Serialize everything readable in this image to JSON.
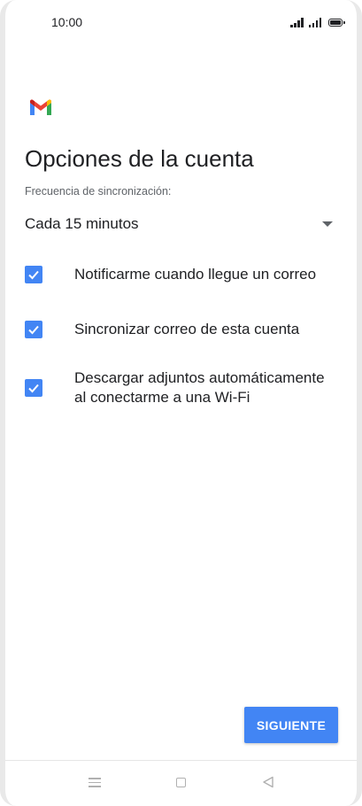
{
  "status_bar": {
    "time": "10:00"
  },
  "header": {
    "title": "Opciones de la cuenta"
  },
  "sync": {
    "label": "Frecuencia de sincronización:",
    "selected": "Cada 15 minutos"
  },
  "options": [
    {
      "label": "Notificarme cuando llegue un correo",
      "checked": true
    },
    {
      "label": "Sincronizar correo de esta cuenta",
      "checked": true
    },
    {
      "label": "Descargar adjuntos automáticamente al conectarme a una Wi-Fi",
      "checked": true
    }
  ],
  "actions": {
    "next_label": "SIGUIENTE"
  },
  "colors": {
    "accent": "#4285f4",
    "text": "#202124",
    "secondary_text": "#5f6368"
  },
  "icons": {
    "logo": "gmail-logo-icon",
    "dropdown": "dropdown-arrow-icon",
    "check": "check-icon",
    "nav_menu": "menu-icon",
    "nav_home": "home-icon",
    "nav_back": "back-icon"
  }
}
